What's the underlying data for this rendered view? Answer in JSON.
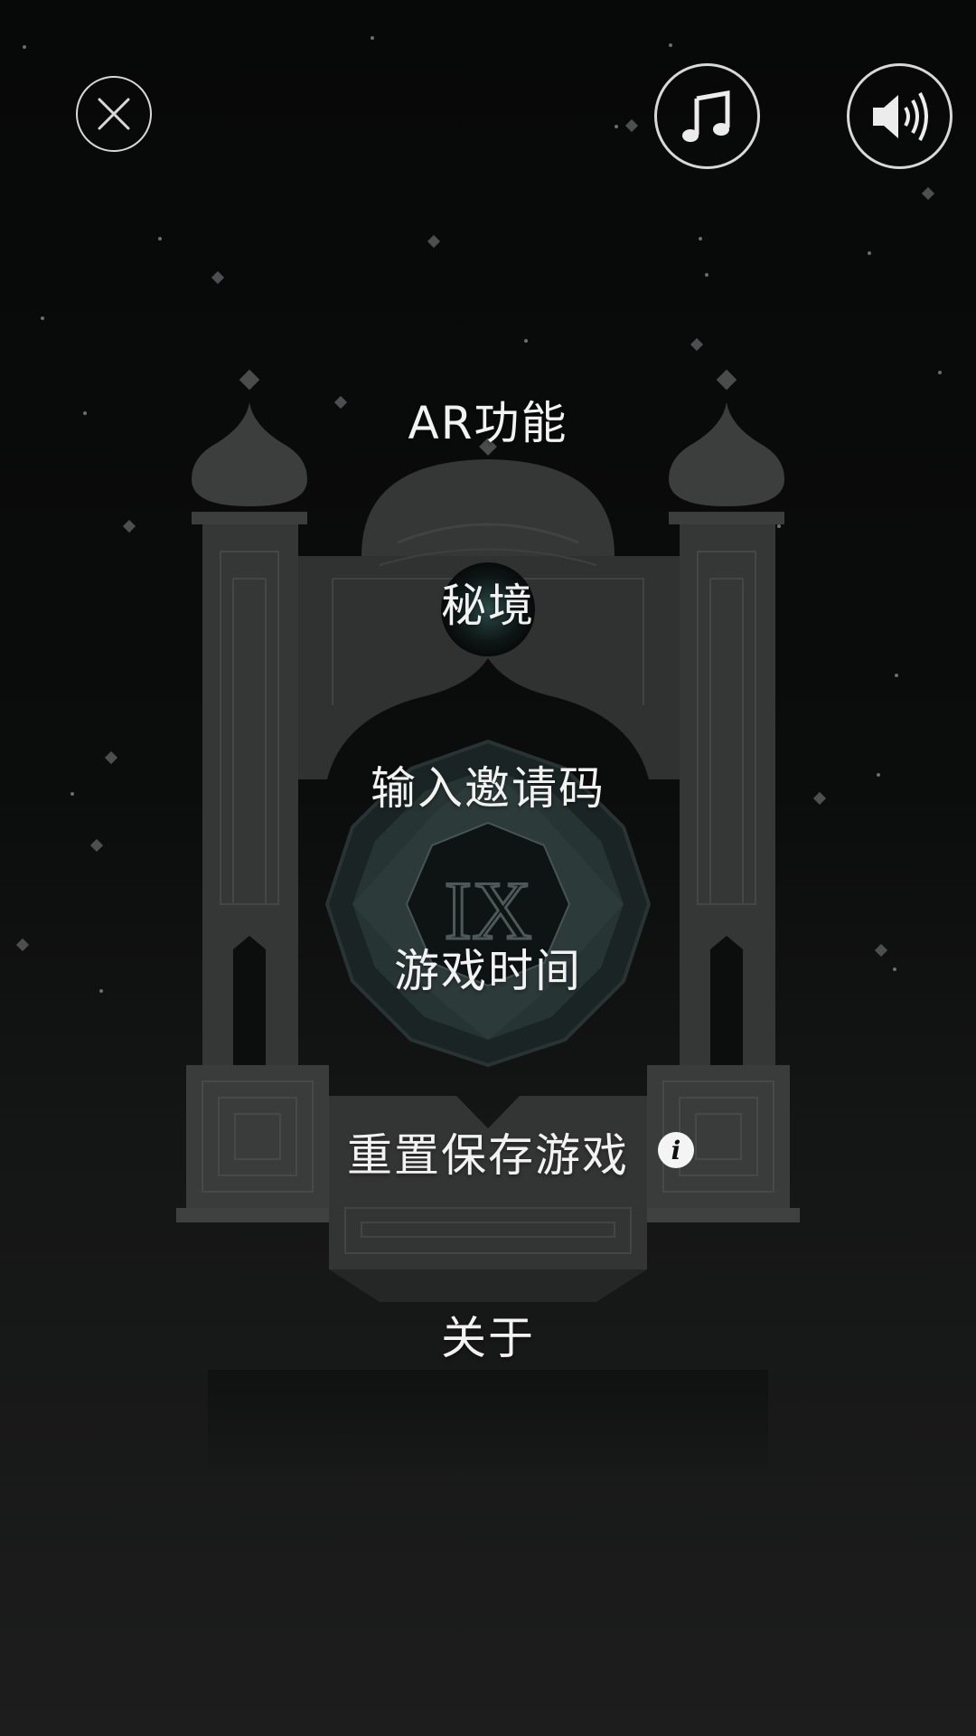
{
  "toolbar": {
    "close_icon": "close-icon",
    "music_icon": "music-note-icon",
    "sound_icon": "speaker-volume-icon"
  },
  "menu": {
    "items": [
      {
        "label": "AR功能"
      },
      {
        "label": "秘境"
      },
      {
        "label": "输入邀请码"
      },
      {
        "label": "游戏时间"
      },
      {
        "label": "重置保存游戏"
      },
      {
        "label": "关于"
      }
    ],
    "info_glyph": "i"
  },
  "scene": {
    "clock_numeral": "IX"
  },
  "colors": {
    "background_top": "#070808",
    "background_bottom": "#1c1d1c",
    "stone": "#353636",
    "text": "#f2f2f2"
  }
}
